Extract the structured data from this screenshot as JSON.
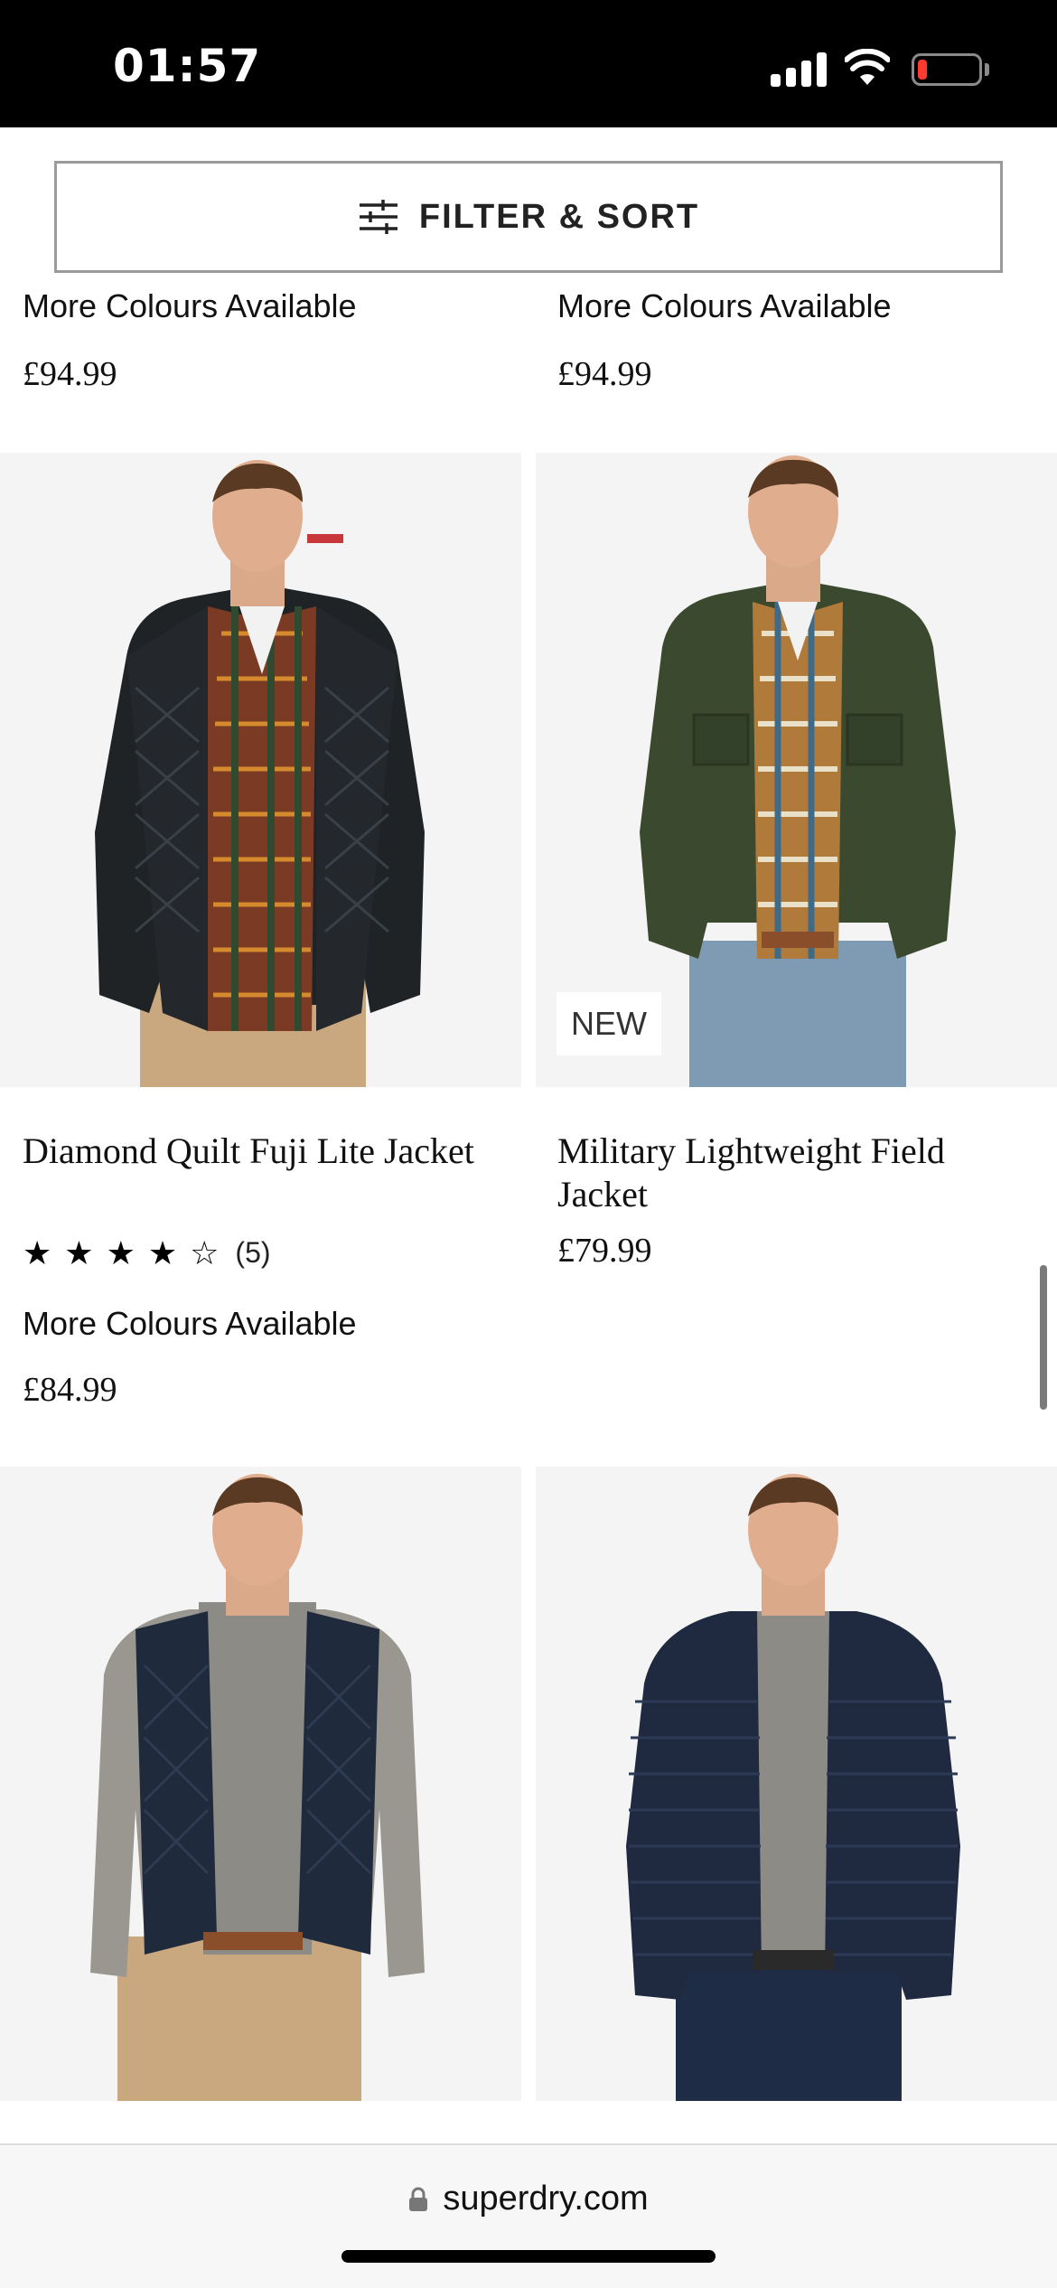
{
  "status_bar": {
    "time": "01:57",
    "battery_level": 0.15
  },
  "filter": {
    "label": "FILTER & SORT",
    "icon": "sliders-icon"
  },
  "previous_row": [
    {
      "colours_text": "More Colours Available",
      "price": "£94.99"
    },
    {
      "colours_text": "More Colours Available",
      "price": "£94.99"
    }
  ],
  "products": [
    {
      "name": "Diamond Quilt Fuji Lite Jacket",
      "rating": 4,
      "rating_max": 5,
      "review_count": "(5)",
      "colours_text": "More Colours Available",
      "price": "£84.99",
      "badge": ""
    },
    {
      "name": "Military Lightweight Field Jacket",
      "price": "£79.99",
      "badge": "NEW"
    },
    {
      "name": "",
      "price": ""
    },
    {
      "name": "",
      "price": ""
    }
  ],
  "browser": {
    "url": "superdry.com"
  },
  "colors": {
    "page_bg": "#ffffff",
    "image_bg": "#f4f4f4",
    "border": "#9a9a9a",
    "battery_low": "#ff3b30"
  }
}
